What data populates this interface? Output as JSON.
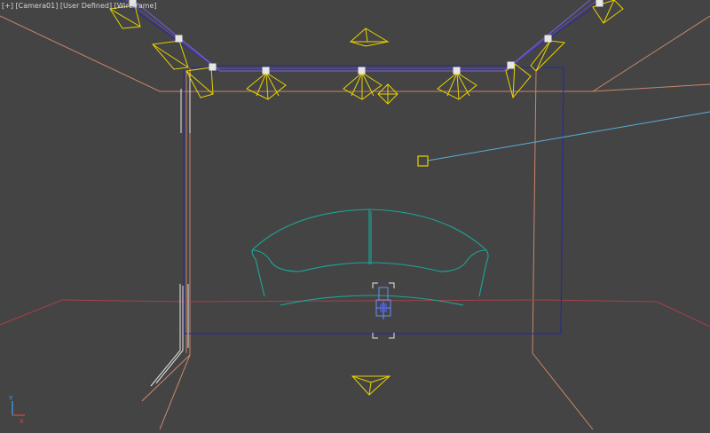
{
  "viewport": {
    "menus": {
      "general": "[+]",
      "camera": "[Camera01]",
      "shading_preset": "[User Defined]",
      "shading_mode": "[Wireframe]"
    },
    "background_color": "#444444",
    "colors": {
      "room_edges": "#c8866a",
      "floor_line": "#a8404a",
      "selection_frame": "#2a2a9a",
      "lights": "#e8d200",
      "sofa": "#1aa898",
      "wall_white": "#e6e6e6",
      "target_line": "#5aaed8",
      "camera": "#6a8cff"
    },
    "axis_gizmo": {
      "x": "X",
      "y": "Y"
    }
  }
}
